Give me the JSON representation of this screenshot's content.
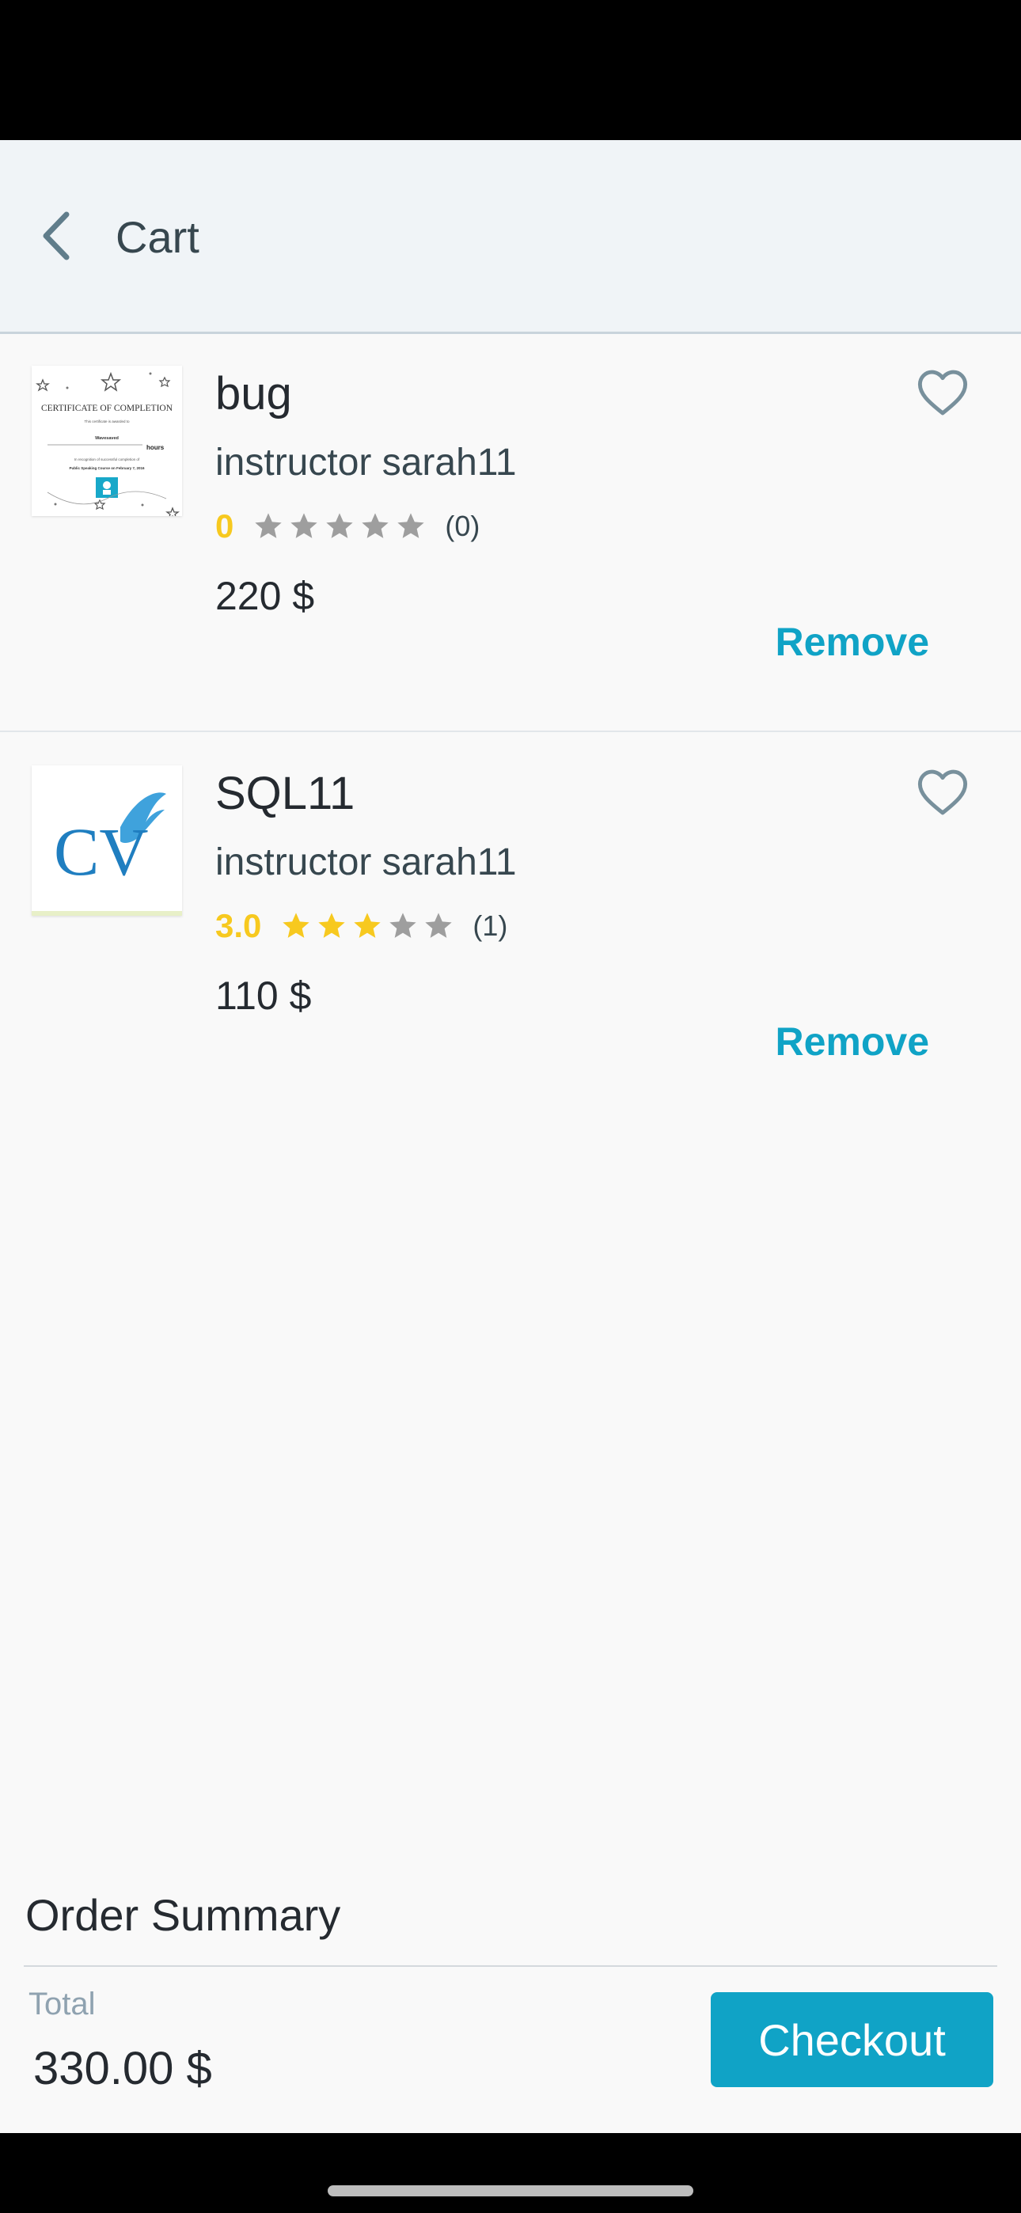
{
  "header": {
    "title": "Cart",
    "back_icon": "chevron-left-icon"
  },
  "items": [
    {
      "title": "bug",
      "instructor": "instructor sarah11",
      "rating": "0",
      "rating_fraction": 0.0,
      "rating_count": "(0)",
      "price": "220 $",
      "remove_label": "Remove",
      "thumbnail": {
        "type": "certificate",
        "title": "CERTIFICATE OF COMPLETION",
        "line_1": "This certificate is awarded to",
        "name": "Wavesaved",
        "hours": "hours",
        "line_2": "In recognition of successful completion of",
        "course": "Public Speaking Course on February 7, 2016"
      }
    },
    {
      "title": "SQL11",
      "instructor": "instructor sarah11",
      "rating": "3.0",
      "rating_fraction": 0.6,
      "rating_count": "(1)",
      "price": "110 $",
      "remove_label": "Remove",
      "thumbnail": {
        "type": "logo",
        "text": "CV"
      }
    }
  ],
  "summary": {
    "title": "Order Summary",
    "total_label": "Total",
    "total_value": "330.00 $",
    "checkout_label": "Checkout"
  },
  "colors": {
    "accent": "#10a3c6",
    "star_filled": "#f7c91f",
    "star_empty": "#9e9e9e",
    "header_bg": "#f0f4f7"
  }
}
